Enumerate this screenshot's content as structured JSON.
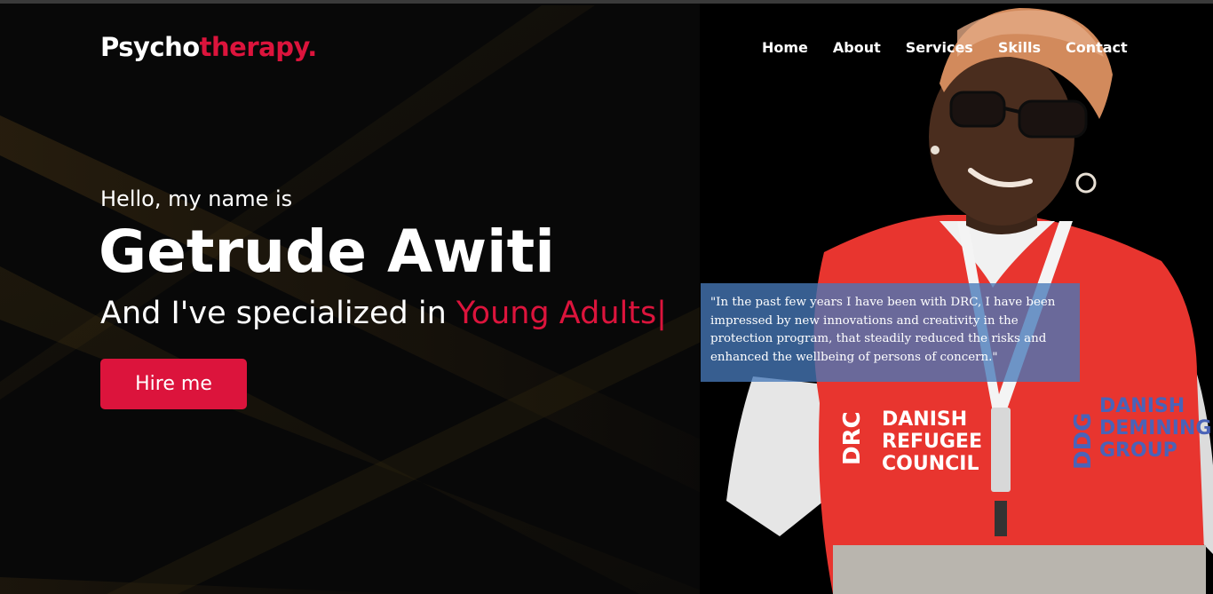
{
  "logo": {
    "main": "Psycho",
    "accent": "therapy."
  },
  "nav": {
    "items": [
      {
        "label": "Home"
      },
      {
        "label": "About"
      },
      {
        "label": "Services"
      },
      {
        "label": "Skills"
      },
      {
        "label": "Contact"
      }
    ]
  },
  "hero": {
    "greeting": "Hello, my name is",
    "name": "Getrude Awiti",
    "specialty_prefix": "And I've specialized in ",
    "specialty_typed": "Young Adults|",
    "hire_label": "Hire me"
  },
  "photo": {
    "quote": "\"In the past few years I have been with DRC, I have been impressed by new innovations and creativity in the protection program, that steadily reduced the risks and enhanced the wellbeing of persons of concern.\"",
    "vest_left_text": "DRC DANISH REFUGEE COUNCIL",
    "vest_right_text": "DDG DANISH DEMINING GROUP"
  },
  "colors": {
    "accent": "#dc143c",
    "background": "#080808",
    "quote_bg": "#4678b9",
    "vest": "#e8352f"
  }
}
